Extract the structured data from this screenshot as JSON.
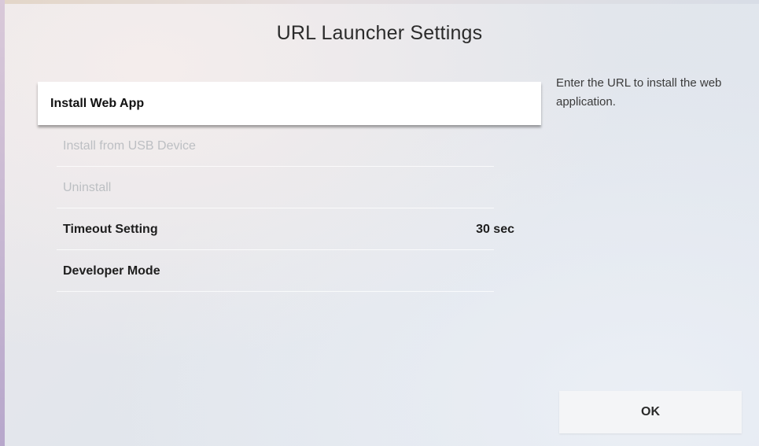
{
  "dialog": {
    "title": "URL Launcher Settings"
  },
  "menu": {
    "items": [
      {
        "label": "Install Web App",
        "value": "",
        "state": "selected"
      },
      {
        "label": "Install from USB Device",
        "value": "",
        "state": "disabled"
      },
      {
        "label": "Uninstall",
        "value": "",
        "state": "disabled"
      },
      {
        "label": "Timeout Setting",
        "value": "30 sec",
        "state": "enabled"
      },
      {
        "label": "Developer Mode",
        "value": "",
        "state": "enabled"
      }
    ]
  },
  "help": {
    "text": "Enter the URL to install the web application."
  },
  "buttons": {
    "ok_label": "OK"
  }
}
